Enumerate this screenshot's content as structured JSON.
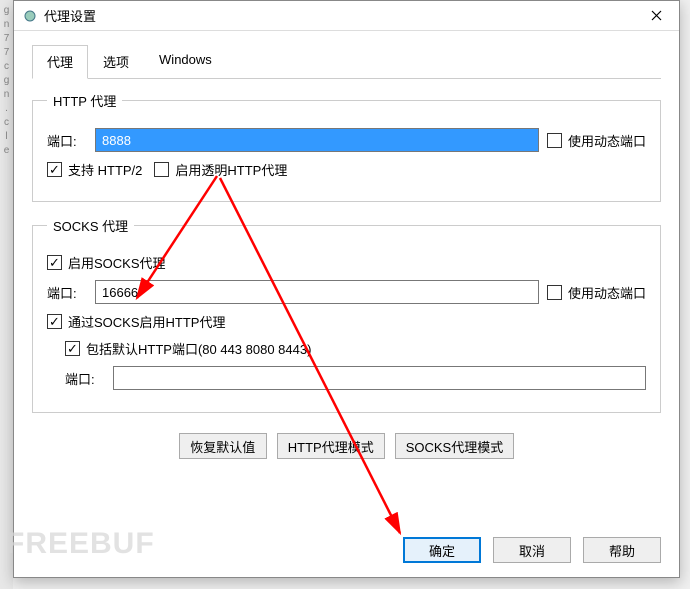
{
  "window": {
    "title": "代理设置"
  },
  "tabs": {
    "proxy": "代理",
    "options": "选项",
    "windows": "Windows"
  },
  "http": {
    "legend": "HTTP 代理",
    "port_label": "端口:",
    "port_value": "8888",
    "dyn_port": "使用动态端口",
    "http2": "支持 HTTP/2",
    "transparent": "启用透明HTTP代理"
  },
  "socks": {
    "legend": "SOCKS 代理",
    "enable": "启用SOCKS代理",
    "port_label": "端口:",
    "port_value": "16666",
    "dyn_port": "使用动态端口",
    "httpvia": "通过SOCKS启用HTTP代理",
    "defports": "包括默认HTTP端口(80 443 8080 8443)",
    "port2_label": "端口:",
    "port2_value": ""
  },
  "modes": {
    "restore": "恢复默认值",
    "http_mode": "HTTP代理模式",
    "socks_mode": "SOCKS代理模式"
  },
  "footer": {
    "ok": "确定",
    "cancel": "取消",
    "help": "帮助"
  },
  "watermark": "FREEBUF"
}
